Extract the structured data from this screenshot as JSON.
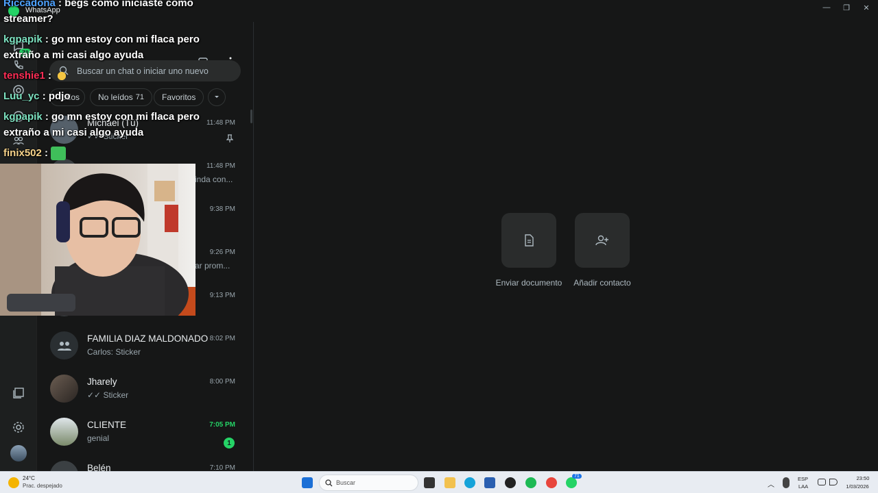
{
  "window": {
    "title": "WhatsApp",
    "min": "—",
    "max": "❐",
    "close": "✕"
  },
  "rail": {
    "badge": "71"
  },
  "search": {
    "placeholder": "Buscar un chat o iniciar uno nuevo"
  },
  "filters": [
    {
      "label": "Todos"
    },
    {
      "label": "No leídos",
      "count": "71"
    },
    {
      "label": "Favoritos"
    }
  ],
  "chats": [
    {
      "name": "Michael (Tú)",
      "preview": "✓✓ Sticker",
      "time": "11:48 PM"
    },
    {
      "name": "",
      "preview": "inda con...",
      "time": "11:48 PM"
    },
    {
      "name": "",
      "preview": "",
      "time": "9:38 PM"
    },
    {
      "name": "",
      "preview": "ar prom...",
      "time": "9:26 PM"
    },
    {
      "name": "",
      "preview": "",
      "time": "9:13 PM"
    },
    {
      "name": "FAMILIA DIAZ MALDONADO",
      "preview": "Carlos: Sticker",
      "time": "8:02 PM"
    },
    {
      "name": "Jharely",
      "preview": "✓✓ Sticker",
      "time": "8:00 PM"
    },
    {
      "name": "CLIENTE",
      "preview": "genial",
      "time": "7:05 PM",
      "unread": "1"
    },
    {
      "name": "Belén",
      "preview": "",
      "time": "7:10 PM"
    }
  ],
  "main": {
    "send_document": "Enviar documento",
    "add_contact": "Añadir contacto"
  },
  "stream_chat": [
    {
      "user": "Riccadona",
      "text": ": begs como iniciaste como streamer?",
      "color": "#4fa3ff"
    },
    {
      "user": "kgpapik",
      "text": ": go mn estoy con mi flaca pero extraño a mi casi algo ayuda",
      "color": "#7de3c1"
    },
    {
      "user": "tenshie1",
      "text": ":",
      "color": "#ff2d55"
    },
    {
      "user": "Luu_yc",
      "text": ": pdjo",
      "color": "#7de3c1"
    },
    {
      "user": "kgpapik",
      "text": ": go mn estoy con mi flaca pero extraño a mi casi algo ayuda",
      "color": "#7de3c1"
    },
    {
      "user": "finix502",
      "text": ":",
      "color": "#f7d38a"
    }
  ],
  "taskbar": {
    "temp": "24°C",
    "weather": "Prac. despejado",
    "search": "Buscar",
    "lang1": "ESP",
    "lang2": "LAA",
    "time": "23:50",
    "date": "1/03/2026",
    "wa_badge": "71"
  }
}
